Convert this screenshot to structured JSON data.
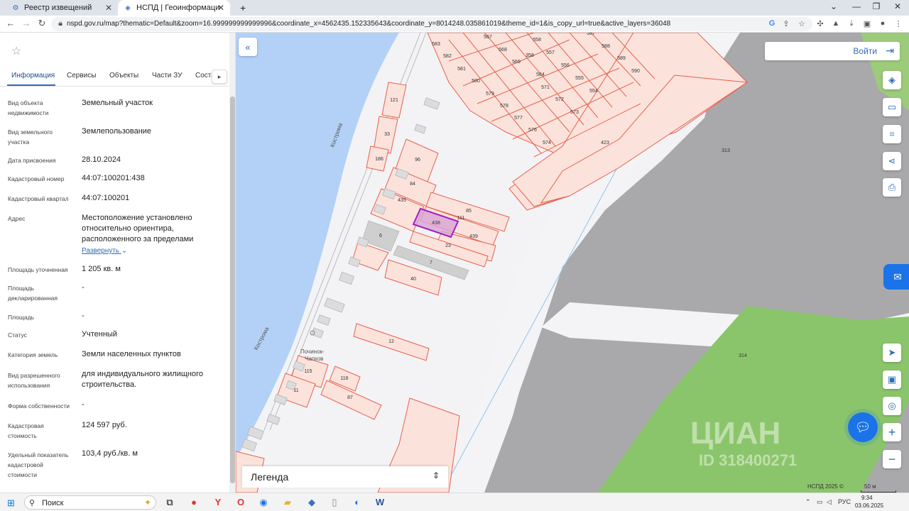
{
  "browser": {
    "tabs": [
      {
        "title": "Реестр извещений",
        "active": false
      },
      {
        "title": "НСПД | Геоинформационный п",
        "active": true
      }
    ],
    "new_tab": "+",
    "url": "nspd.gov.ru/map?thematic=Default&zoom=16.999999999999996&coordinate_x=4562435.152335643&coordinate_y=8014248.035861019&theme_id=1&is_copy_url=true&active_layers=36048"
  },
  "panel": {
    "tabs": [
      "Информация",
      "Сервисы",
      "Объекты",
      "Части ЗУ",
      "Соста"
    ],
    "fields": [
      {
        "label": "Вид объекта недвижимости",
        "value": "Земельный участок"
      },
      {
        "label": "Вид земельного участка",
        "value": "Землепользование"
      },
      {
        "label": "Дата присвоения",
        "value": "28.10.2024"
      },
      {
        "label": "Кадастровый номер",
        "value": "44:07:100201:438"
      },
      {
        "label": "Кадастровый квартал",
        "value": "44:07:100201"
      },
      {
        "label": "Адрес",
        "value": "Местоположение установлено относительно ориентира, расположенного за пределами"
      },
      {
        "label": "Площадь уточненная",
        "value": "1 205 кв. м"
      },
      {
        "label": "Площадь декларированная",
        "value": "-"
      },
      {
        "label": "Площадь",
        "value": "-"
      },
      {
        "label": "Статус",
        "value": "Учтенный"
      },
      {
        "label": "Категория земель",
        "value": "Земли населенных пунктов"
      },
      {
        "label": "Вид разрешенного использования",
        "value": "для индивидуального жилищного строительства."
      },
      {
        "label": "Форма собственности",
        "value": "-"
      },
      {
        "label": "Кадастровая стоимость",
        "value": "124 597 руб."
      },
      {
        "label": "Удельный показатель кадастровой стоимости",
        "value": "103,4 руб./кв. м"
      }
    ],
    "expand_label": "Развернуть"
  },
  "map": {
    "login_label": "Войти",
    "legend_label": "Легенда",
    "attribution": "НСПД 2025 ©",
    "scale_label": "50 м",
    "river_labels": [
      "Кострома",
      "Кострома"
    ],
    "village_label": [
      "Починок-",
      "Чапков"
    ],
    "selected_parcel": "438",
    "parcels": [
      "567",
      "583",
      "568",
      "558",
      "587",
      "588",
      "582",
      "569",
      "358",
      "557",
      "589",
      "581",
      "556",
      "590",
      "584",
      "580",
      "555",
      "571",
      "579",
      "554",
      "572",
      "578",
      "573",
      "577",
      "576",
      "574",
      "423",
      "121",
      "313",
      "33",
      "186",
      "96",
      "84",
      "435",
      "85",
      "111",
      "6",
      "439",
      "23",
      "7",
      "40",
      "12",
      "314",
      "115",
      "116",
      "11",
      "87"
    ],
    "watermark": [
      "ЦИАН",
      "ID 318400271"
    ],
    "accent_color": "#2f6cb5",
    "parcel_stroke_color": "#e8604c",
    "selected_color": "#a020c0"
  },
  "taskbar": {
    "search_label": "Поиск",
    "lang": "РУС",
    "time": "9:34",
    "date": "03.06.2025"
  }
}
